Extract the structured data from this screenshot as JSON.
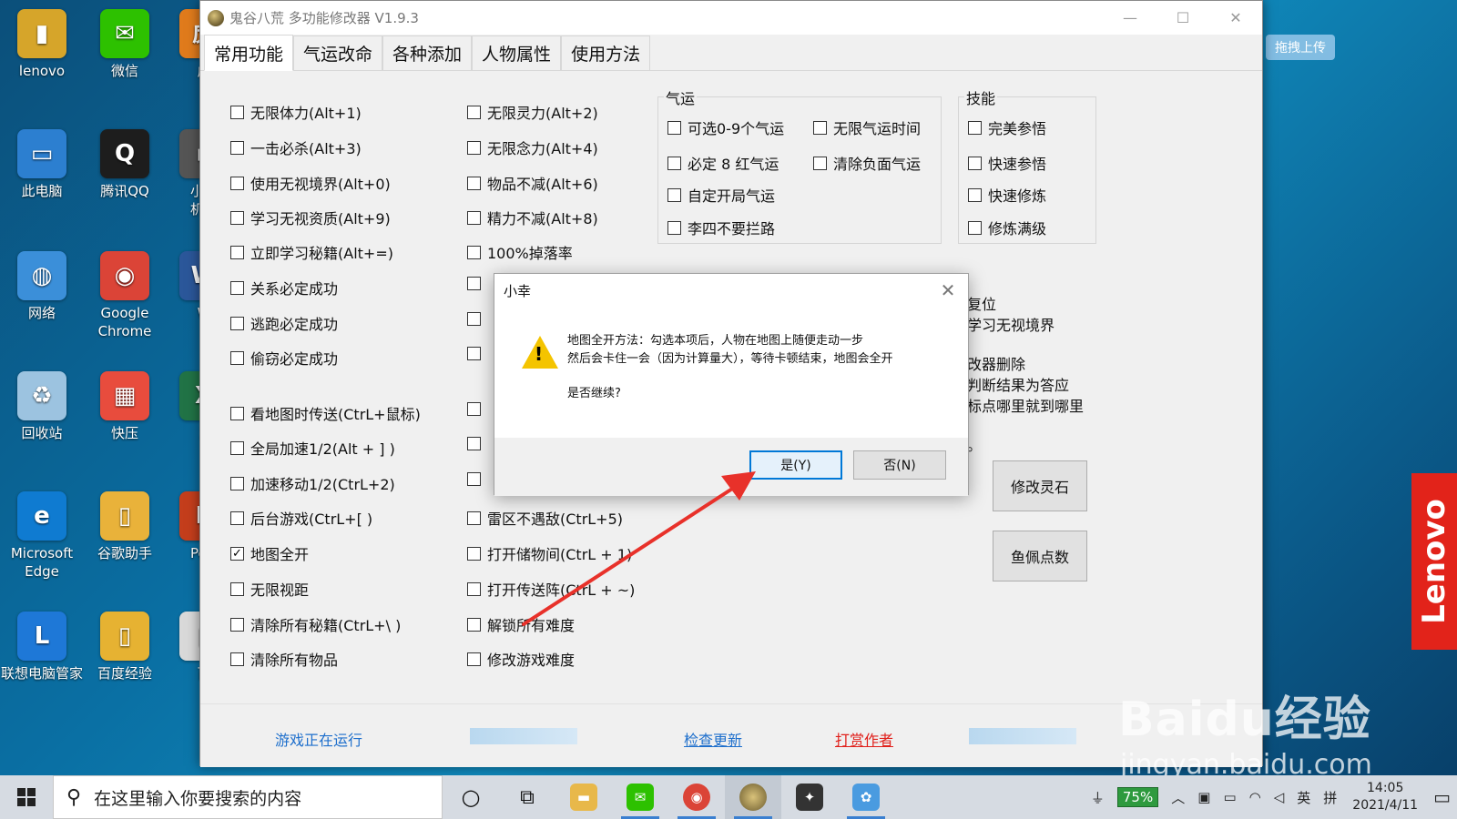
{
  "desktop": {
    "icons": [
      {
        "label": "lenovo",
        "color": "#d6a52a",
        "glyph": "▮"
      },
      {
        "label": "微信",
        "color": "#2dc100",
        "glyph": "✉"
      },
      {
        "label": "虎",
        "color": "#e07b1c",
        "glyph": "虎"
      },
      {
        "label": "此电脑",
        "color": "#2c7fd0",
        "glyph": "▭"
      },
      {
        "label": "腾讯QQ",
        "color": "#1d1d1d",
        "glyph": "Q"
      },
      {
        "label": "小黑\n机二",
        "color": "#555555",
        "glyph": "▪"
      },
      {
        "label": "网络",
        "color": "#3b8fd9",
        "glyph": "◍"
      },
      {
        "label": "Google\nChrome",
        "color": "#db4437",
        "glyph": "◉"
      },
      {
        "label": "W",
        "color": "#2b579a",
        "glyph": "W"
      },
      {
        "label": "回收站",
        "color": "#9cc3e0",
        "glyph": "♻"
      },
      {
        "label": "快压",
        "color": "#e84c3d",
        "glyph": "▦"
      },
      {
        "label": "X",
        "color": "#217346",
        "glyph": "X"
      },
      {
        "label": "Microsoft\nEdge",
        "color": "#0f7bd1",
        "glyph": "e"
      },
      {
        "label": "谷歌助手",
        "color": "#e9b23a",
        "glyph": "▯"
      },
      {
        "label": "Pow",
        "color": "#c43e1c",
        "glyph": "P"
      },
      {
        "label": "联想电脑管家",
        "color": "#1e78d7",
        "glyph": "L"
      },
      {
        "label": "百度经验",
        "color": "#e6b232",
        "glyph": "▯"
      },
      {
        "label": "百",
        "color": "#d9d9d9",
        "glyph": "▯"
      }
    ],
    "upload_button": "拖拽上传",
    "brand_tag": "Lenovo",
    "watermark_main": "Baidu经验",
    "watermark_sub": "jingyan.baidu.com"
  },
  "window": {
    "title": "鬼谷八荒 多功能修改器  V1.9.3",
    "controls": {
      "minimize": "—",
      "maximize": "☐",
      "close": "✕"
    },
    "tabs": [
      {
        "label": "常用功能",
        "active": true
      },
      {
        "label": "气运改命",
        "active": false
      },
      {
        "label": "各种添加",
        "active": false
      },
      {
        "label": "人物属性",
        "active": false
      },
      {
        "label": "使用方法",
        "active": false
      }
    ],
    "col1": [
      {
        "label": "无限体力(Alt+1)",
        "checked": false
      },
      {
        "label": "一击必杀(Alt+3)",
        "checked": false
      },
      {
        "label": "使用无视境界(Alt+0)",
        "checked": false
      },
      {
        "label": "学习无视资质(Alt+9)",
        "checked": false
      },
      {
        "label": "立即学习秘籍(Alt+=)",
        "checked": false
      },
      {
        "label": "关系必定成功",
        "checked": false
      },
      {
        "label": "逃跑必定成功",
        "checked": false
      },
      {
        "label": "偷窃必定成功",
        "checked": false
      },
      {
        "label": "看地图时传送(CtrL+鼠标)",
        "checked": false
      },
      {
        "label": "全局加速1/2(Alt + ] )",
        "checked": false
      },
      {
        "label": "加速移动1/2(CtrL+2)",
        "checked": false
      },
      {
        "label": "后台游戏(CtrL+[ )",
        "checked": false
      },
      {
        "label": "地图全开",
        "checked": true
      },
      {
        "label": "无限视距",
        "checked": false
      },
      {
        "label": "清除所有秘籍(CtrL+\\ )",
        "checked": false
      },
      {
        "label": "清除所有物品",
        "checked": false
      }
    ],
    "col2": [
      {
        "label": "无限灵力(Alt+2)",
        "checked": false
      },
      {
        "label": "无限念力(Alt+4)",
        "checked": false
      },
      {
        "label": "物品不减(Alt+6)",
        "checked": false
      },
      {
        "label": "精力不减(Alt+8)",
        "checked": false
      },
      {
        "label": "100%掉落率",
        "checked": false
      },
      {
        "label": "",
        "checked": false
      },
      {
        "label": "",
        "checked": false
      },
      {
        "label": "",
        "checked": false
      },
      {
        "label": "",
        "checked": false
      },
      {
        "label": "",
        "checked": false
      },
      {
        "label": "",
        "checked": false
      },
      {
        "label": "雷区不遇敌(CtrL+5)",
        "checked": false
      },
      {
        "label": "打开储物间(CtrL + 1)",
        "checked": false
      },
      {
        "label": "打开传送阵(CtrL + ~)",
        "checked": false
      },
      {
        "label": "解锁所有难度",
        "checked": false
      },
      {
        "label": "修改游戏难度",
        "checked": false
      }
    ],
    "qiyun": {
      "title": "气运",
      "items": [
        {
          "label": "可选0-9个气运",
          "checked": false
        },
        {
          "label": "无限气运时间",
          "checked": false
        },
        {
          "label": "必定 8 红气运",
          "checked": false
        },
        {
          "label": "清除负面气运",
          "checked": false
        },
        {
          "label": "自定开局气运",
          "checked": false
        },
        {
          "label": "李四不要拦路",
          "checked": false
        }
      ]
    },
    "skills": {
      "title": "技能",
      "items": [
        {
          "label": "完美参悟",
          "checked": false
        },
        {
          "label": "快速参悟",
          "checked": false
        },
        {
          "label": "快速修炼",
          "checked": false
        },
        {
          "label": "修炼满级",
          "checked": false
        }
      ]
    },
    "info_lines": [
      "会复位",
      "含学习无视境界",
      "修改器删除",
      "时判断结果为答应",
      "鼠标点哪里就到哪里",
      "器。"
    ],
    "buttons": {
      "modify_stone": "修改灵石",
      "fish_points": "鱼佩点数"
    },
    "footer": {
      "status": "游戏正在运行",
      "check_update": "检查更新",
      "donate": "打赏作者"
    }
  },
  "dialog": {
    "title": "小幸",
    "close": "✕",
    "line1": "地图全开方法：勾选本项后，人物在地图上随便走动一步",
    "line2": "然后会卡住一会（因为计算量大），等待卡顿结束，地图会全开",
    "question": "是否继续?",
    "yes": "是(Y)",
    "no": "否(N)"
  },
  "taskbar": {
    "search_placeholder": "在这里输入你要搜索的内容",
    "battery": "75%",
    "ime_lang": "英",
    "ime_mode": "拼",
    "time": "14:05",
    "date": "2021/4/11"
  },
  "colors": {
    "link": "#1e6fcc",
    "donate": "#e0201b",
    "accent": "#0078d7",
    "warning": "#f4c400",
    "arrow": "#e8312a"
  }
}
